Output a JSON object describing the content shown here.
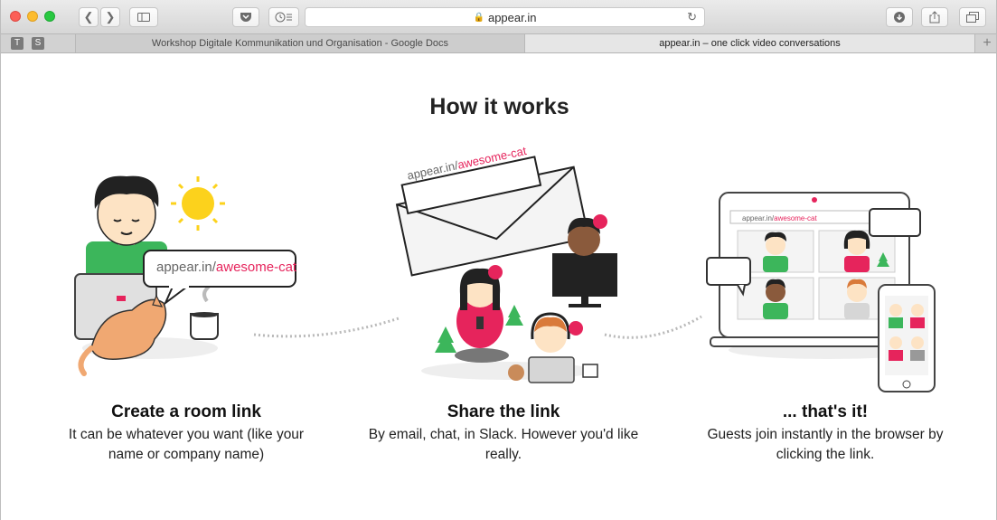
{
  "browser": {
    "url": "appear.in",
    "tabs": [
      {
        "label": "Workshop Digitale Kommunikation und Organisation - Google Docs",
        "active": false
      },
      {
        "label": "appear.in – one click video conversations",
        "active": true
      }
    ],
    "pinned_tabs": [
      "T",
      "S"
    ],
    "icons": [
      "back-icon",
      "forward-icon",
      "sidebar-icon",
      "pocket-icon",
      "reading-list-icon",
      "reload-icon",
      "download-icon",
      "share-icon",
      "tabs-overview-icon",
      "new-tab-icon"
    ]
  },
  "page": {
    "heading": "How it works",
    "illustration_link_prefix": "appear.in/",
    "illustration_link_room": "awesome-cat",
    "steps": [
      {
        "title": "Create a room link",
        "description": "It can be whatever you want (like your name or company name)"
      },
      {
        "title": "Share the link",
        "description": "By email, chat, in Slack. However you'd like really."
      },
      {
        "title": "... that's it!",
        "description": "Guests join instantly in the browser by clicking the link."
      }
    ]
  },
  "colors": {
    "accent": "#e6245c",
    "text": "#222222",
    "toolbar": "#e2e2e2"
  }
}
